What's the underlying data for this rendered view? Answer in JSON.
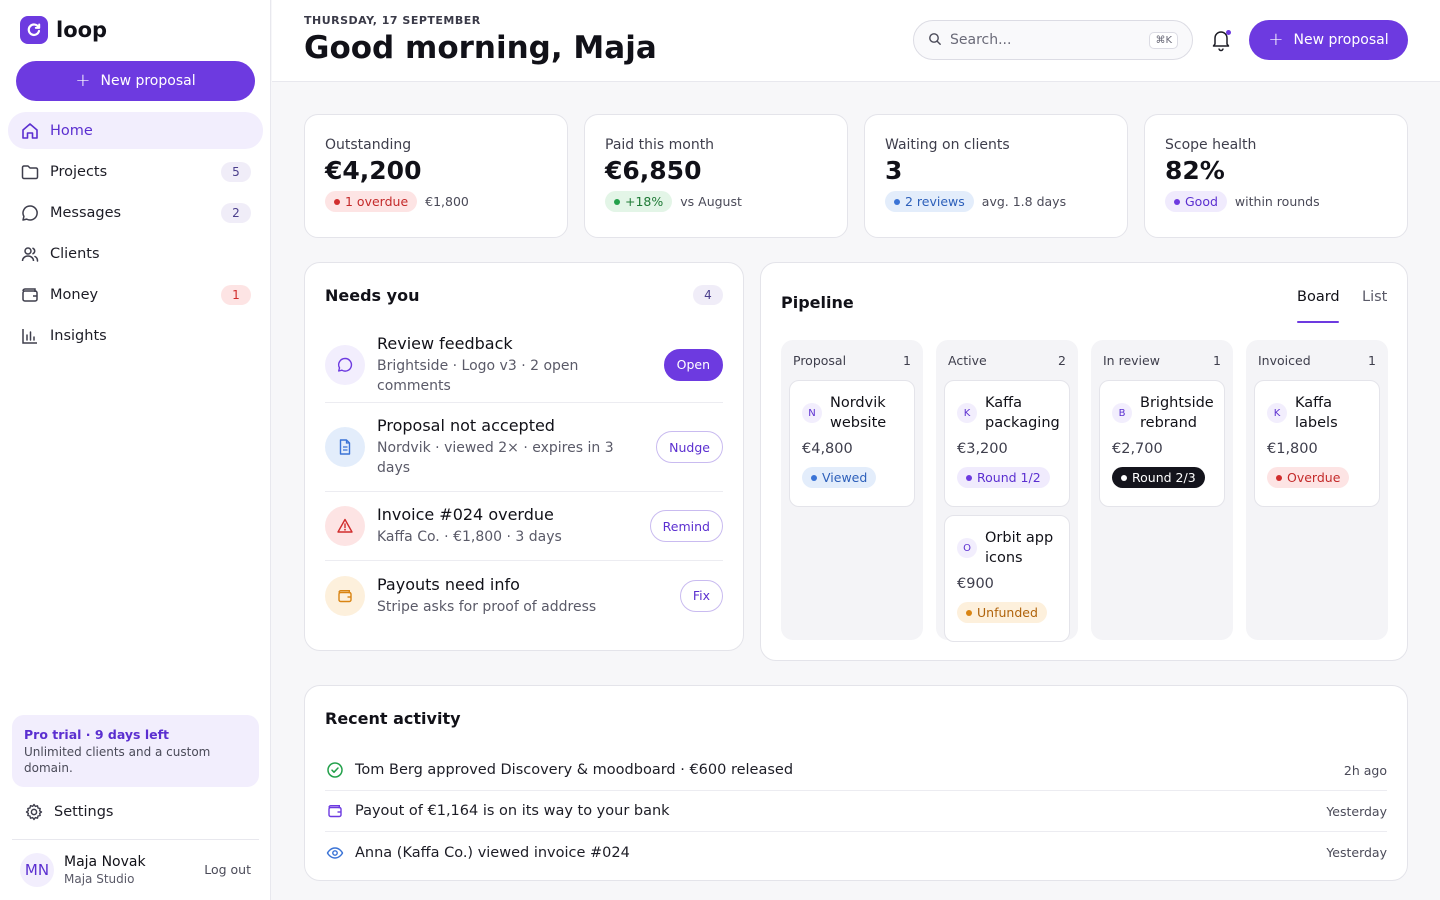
{
  "app": {
    "name": "loop"
  },
  "sidebar": {
    "new_proposal": "New proposal",
    "items": [
      {
        "label": "Home",
        "icon": "home-icon"
      },
      {
        "label": "Projects",
        "icon": "folder-icon",
        "badge": "5"
      },
      {
        "label": "Messages",
        "icon": "message-icon",
        "badge": "2"
      },
      {
        "label": "Clients",
        "icon": "users-icon"
      },
      {
        "label": "Money",
        "icon": "wallet-icon",
        "badge": "1"
      },
      {
        "label": "Insights",
        "icon": "chart-icon"
      }
    ],
    "trial": {
      "title": "Pro trial · 9 days left",
      "text": "Unlimited clients and a custom domain."
    },
    "settings": "Settings",
    "user": {
      "initials": "MN",
      "name": "Maja Novak",
      "org": "Maja Studio",
      "logout": "Log out"
    }
  },
  "header": {
    "date": "THURSDAY, 17 SEPTEMBER",
    "greeting": "Good morning, Maja",
    "search_placeholder": "Search...",
    "search_shortcut": "⌘K",
    "new_proposal": "New proposal"
  },
  "stats": [
    {
      "label": "Outstanding",
      "value": "€4,200",
      "pill": "1 overdue",
      "pill_color": "red",
      "sub": "€1,800"
    },
    {
      "label": "Paid this month",
      "value": "€6,850",
      "pill": "+18%",
      "pill_color": "green",
      "sub": "vs August"
    },
    {
      "label": "Waiting on clients",
      "value": "3",
      "pill": "2 reviews",
      "pill_color": "blue",
      "sub": "avg. 1.8 days"
    },
    {
      "label": "Scope health",
      "value": "82%",
      "pill": "Good",
      "pill_color": "purple",
      "sub": "within rounds"
    }
  ],
  "needs": {
    "title": "Needs you",
    "count": "4",
    "tasks": [
      {
        "title": "Review feedback",
        "sub": "Brightside · Logo v3 · 2 open comments",
        "action": "Open",
        "icon": "comment-icon"
      },
      {
        "title": "Proposal not accepted",
        "sub": "Nordvik · viewed 2× · expires in 3 days",
        "action": "Nudge",
        "icon": "document-icon"
      },
      {
        "title": "Invoice #024 overdue",
        "sub": "Kaffa Co. · €1,800 · 3 days",
        "action": "Remind",
        "icon": "warning-icon"
      },
      {
        "title": "Payouts need info",
        "sub": "Stripe asks for proof of address",
        "action": "Fix",
        "icon": "wallet-icon"
      }
    ]
  },
  "pipeline": {
    "title": "Pipeline",
    "tabs": [
      "Board",
      "List"
    ],
    "columns": [
      {
        "name": "Proposal",
        "count": "1",
        "deals": [
          {
            "initial": "N",
            "name": "Nordvik website",
            "amount": "€4,800",
            "status": "Viewed",
            "status_color": "blue"
          }
        ]
      },
      {
        "name": "Active",
        "count": "2",
        "deals": [
          {
            "initial": "K",
            "name": "Kaffa packaging",
            "amount": "€3,200",
            "status": "Round 1/2",
            "status_color": "purple"
          },
          {
            "initial": "O",
            "name": "Orbit app icons",
            "amount": "€900",
            "status": "Unfunded",
            "status_color": "orange"
          }
        ]
      },
      {
        "name": "In review",
        "count": "1",
        "deals": [
          {
            "initial": "B",
            "name": "Brightside rebrand",
            "amount": "€2,700",
            "status": "Round 2/3",
            "status_color": "dark"
          }
        ]
      },
      {
        "name": "Invoiced",
        "count": "1",
        "deals": [
          {
            "initial": "K",
            "name": "Kaffa labels",
            "amount": "€1,800",
            "status": "Overdue",
            "status_color": "red"
          }
        ]
      }
    ]
  },
  "activity": {
    "title": "Recent activity",
    "items": [
      {
        "text": "Tom Berg approved Discovery & moodboard · €600 released",
        "time": "2h ago",
        "icon": "check-circle-icon"
      },
      {
        "text": "Payout of €1,164 is on its way to your bank",
        "time": "Yesterday",
        "icon": "wallet-icon"
      },
      {
        "text": "Anna (Kaffa Co.) viewed invoice #024",
        "time": "Yesterday",
        "icon": "eye-icon"
      }
    ]
  },
  "colors": {
    "accent": "#6d3ae0",
    "accent_soft": "#f2eefd",
    "danger": "#d12d2d",
    "success": "#22a04a",
    "info": "#3a73d6",
    "warning": "#d98412"
  }
}
